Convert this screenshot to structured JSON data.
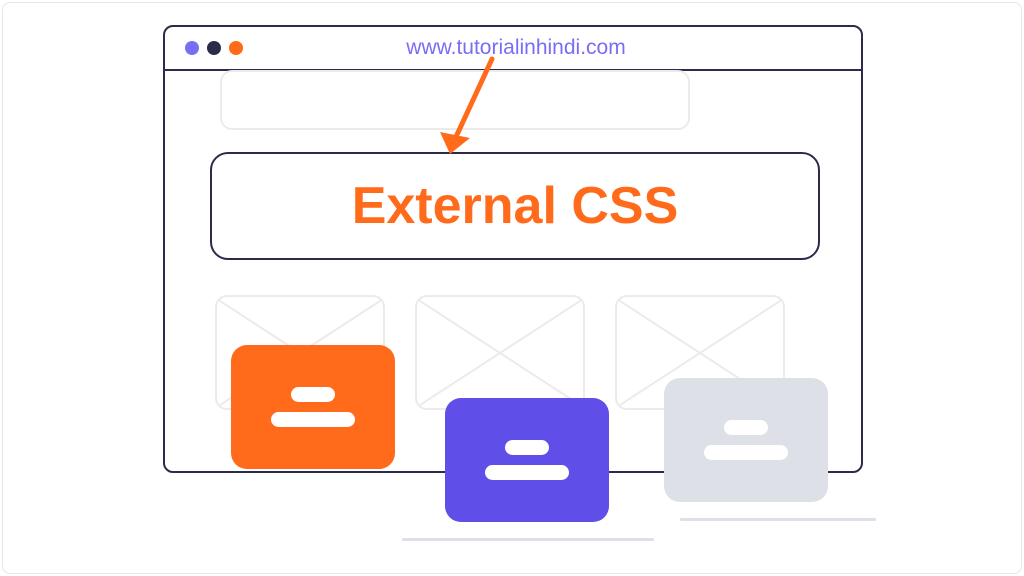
{
  "browser": {
    "url": "www.tutorialinhindi.com",
    "traffic_lights": [
      "purple",
      "dark",
      "orange"
    ]
  },
  "main": {
    "title": "External CSS"
  },
  "cards": {
    "card1_color": "orange",
    "card2_color": "purple",
    "card3_color": "gray"
  },
  "colors": {
    "accent_orange": "#ff6b1a",
    "accent_purple": "#5f4fe8",
    "dark": "#2c2c4a",
    "light_gray": "#dee0e8"
  }
}
